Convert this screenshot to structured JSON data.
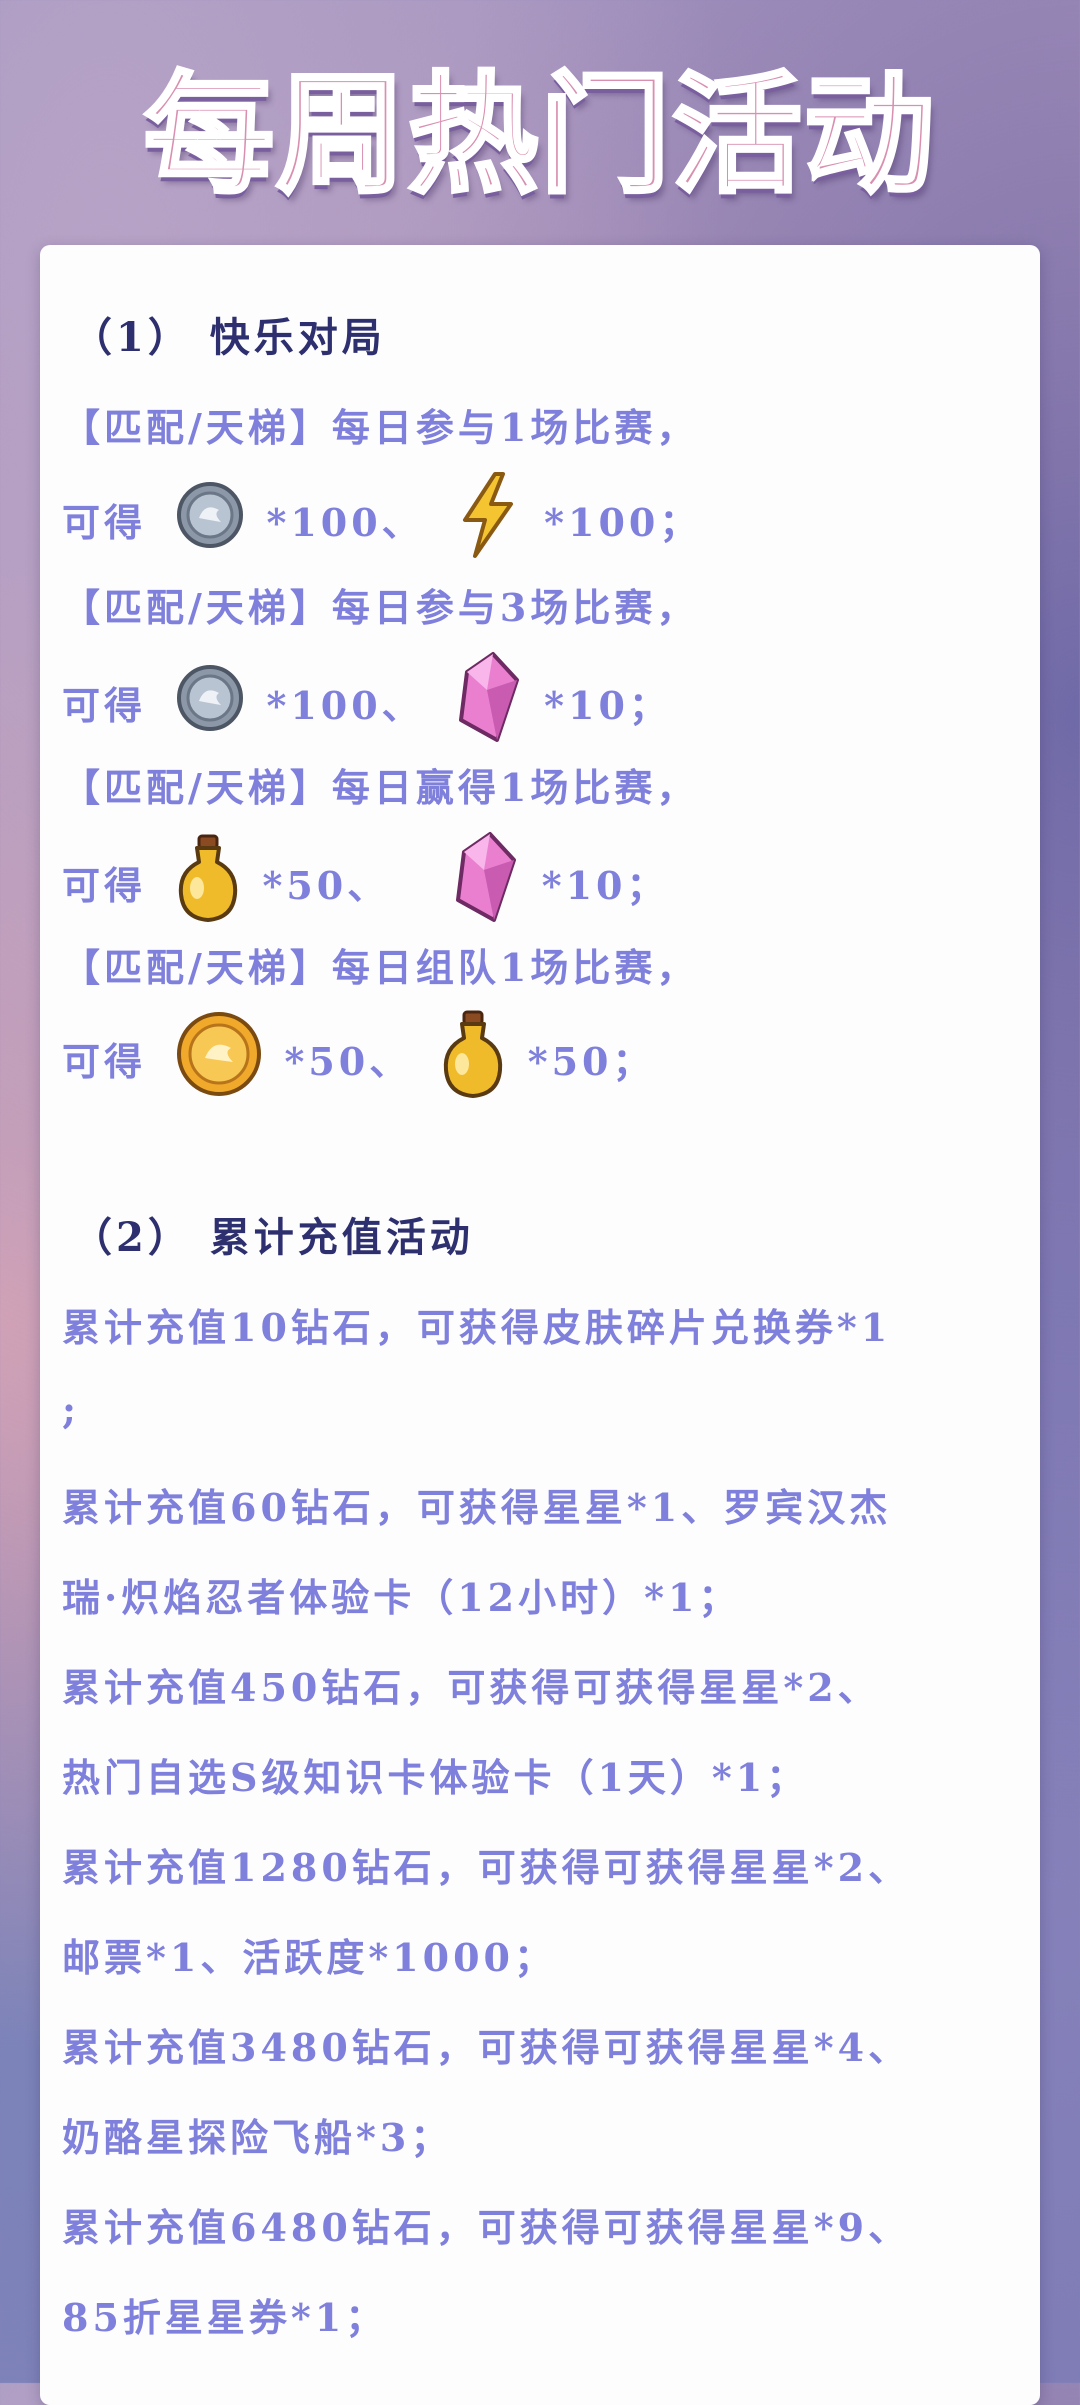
{
  "title": "每周热门活动",
  "section1": {
    "heading": "（1） 快乐对局",
    "items": [
      {
        "condition": "【匹配/天梯】每日参与1场比赛，",
        "prefix": "可得",
        "reward1_qty": "*100、",
        "reward1_icon": "silver-coin-icon",
        "reward2_qty": "*100；",
        "reward2_icon": "lightning-icon"
      },
      {
        "condition": "【匹配/天梯】每日参与3场比赛，",
        "prefix": "可得",
        "reward1_qty": "*100、",
        "reward1_icon": "silver-coin-icon",
        "reward2_qty": "*10；",
        "reward2_icon": "pink-crystal-icon"
      },
      {
        "condition": "【匹配/天梯】每日赢得1场比赛，",
        "prefix": "可得",
        "reward1_qty": "*50、",
        "reward1_icon": "potion-icon",
        "reward2_qty": "*10；",
        "reward2_icon": "pink-crystal-icon"
      },
      {
        "condition": "【匹配/天梯】每日组队1场比赛，",
        "prefix": "可得",
        "reward1_qty": "*50、",
        "reward1_icon": "gold-coin-icon",
        "reward2_qty": "*50；",
        "reward2_icon": "potion-icon"
      }
    ]
  },
  "section2": {
    "heading": "（2） 累计充值活动",
    "lines": [
      "累计充值10钻石，可获得皮肤碎片兑换券*1",
      ";",
      "累计充值60钻石，可获得星星*1、罗宾汉杰",
      "瑞·炽焰忍者体验卡（12小时）*1；",
      "累计充值450钻石，可获得可获得星星*2、",
      "热门自选S级知识卡体验卡（1天）*1；",
      "累计充值1280钻石，可获得可获得星星*2、",
      "邮票*1、活跃度*1000；",
      "累计充值3480钻石，可获得可获得星星*4、",
      "奶酪星探险飞船*3；",
      "累计充值6480钻石，可获得可获得星星*9、",
      "85折星星券*1；"
    ]
  },
  "colors": {
    "heading": "#2d2f6f",
    "text": "#7f7fdc",
    "title_fill": "#d98fb0"
  }
}
